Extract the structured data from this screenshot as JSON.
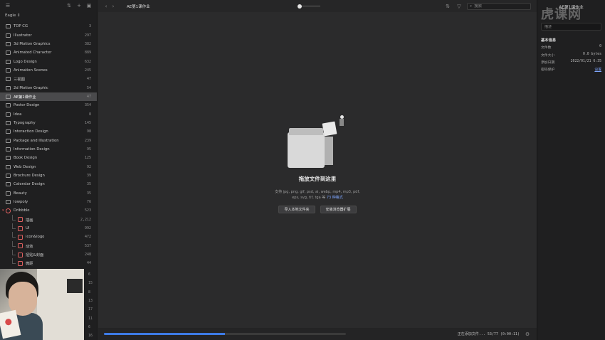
{
  "library": {
    "name": "Eagle ⇕"
  },
  "folders": [
    {
      "label": "TOP CG",
      "count": "3"
    },
    {
      "label": "Illustrator",
      "count": "297"
    },
    {
      "label": "3d Motion Graphics",
      "count": "382"
    },
    {
      "label": "Animated Character",
      "count": "889"
    },
    {
      "label": "Logo Design",
      "count": "632"
    },
    {
      "label": "Animation Scenes",
      "count": "245"
    },
    {
      "label": "三视图",
      "count": "47"
    },
    {
      "label": "2d Motion Graphic",
      "count": "54"
    },
    {
      "label": "AE第1课作业",
      "count": "47"
    },
    {
      "label": "Poster Design",
      "count": "354"
    },
    {
      "label": "Idea",
      "count": "8"
    },
    {
      "label": "Typography",
      "count": "145"
    },
    {
      "label": "Interaction Design",
      "count": "98"
    },
    {
      "label": "Package and Illustration",
      "count": "239"
    },
    {
      "label": "Information Design",
      "count": "95"
    },
    {
      "label": "Book Design",
      "count": "125"
    },
    {
      "label": "Web Design",
      "count": "92"
    },
    {
      "label": "Brochure Design",
      "count": "39"
    },
    {
      "label": "Calendar Design",
      "count": "35"
    },
    {
      "label": "Beauty",
      "count": "35"
    },
    {
      "label": "lowpoly",
      "count": "76"
    }
  ],
  "dribbble": {
    "label": "Dribbble",
    "count": "523",
    "children": [
      {
        "label": "插画",
        "count": "2,212"
      },
      {
        "label": "UI",
        "count": "992"
      },
      {
        "label": "icon&logo",
        "count": "472"
      },
      {
        "label": "动效",
        "count": "537"
      },
      {
        "label": "招贴&封面",
        "count": "248"
      },
      {
        "label": "微距",
        "count": "44"
      }
    ]
  },
  "strip_counts": [
    "6",
    "15",
    "8",
    "13",
    "17",
    "11",
    "6",
    "16",
    "8"
  ],
  "toolbar": {
    "title": "AE第1课作业",
    "search_placeholder": "搜索"
  },
  "empty_state": {
    "heading": "拖放文件到这里",
    "line1": "支持 jpg, png, gif, psd, ai, webp, mp4, mp3, pdf,",
    "line2_prefix": "eps, svg, tif, tga 等",
    "line2_link": "73 种格式",
    "button_import": "导入本地文件夹",
    "button_extension": "安装浏览器扩展"
  },
  "inspector": {
    "title": "AE第1课作业",
    "desc_placeholder": "描述",
    "section": "基本信息",
    "rows": [
      {
        "k": "文件数",
        "v": "0"
      },
      {
        "k": "文件大小",
        "v": "0.0 bytes"
      },
      {
        "k": "添加日期",
        "v": "2022/01/21 6:35"
      },
      {
        "k": "密码保护",
        "v": "设置"
      }
    ]
  },
  "watermark": "虎课网",
  "status": {
    "text": "正在添加文件... 53/77 (0:00:11)",
    "progress": 0.5
  },
  "colors": {
    "accent": "#3d7be6",
    "active_row": "#4a4a4c",
    "dribbble": "#e06060"
  }
}
